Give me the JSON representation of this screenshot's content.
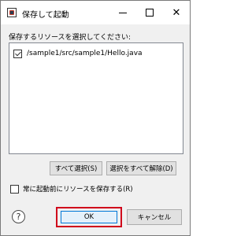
{
  "window": {
    "title": "保存して起動",
    "app_icon": "eclipse-app-icon",
    "controls": {
      "minimize": "minimize-icon",
      "maximize": "maximize-icon",
      "close": "close-icon",
      "close_glyph": "✕"
    }
  },
  "prompt": "保存するリソースを選択してください:",
  "resources": [
    {
      "label": "/sample1/src/sample1/Hello.java",
      "checked": true
    }
  ],
  "buttons": {
    "select_all": "すべて選択(S)",
    "deselect_all": "選択をすべて解除(D)",
    "ok": "OK",
    "cancel": "キャンセル"
  },
  "save_before_launch": {
    "label": "常に起動前にリソースを保存する(R)",
    "checked": false
  },
  "help": {
    "glyph": "?",
    "icon": "help-icon"
  },
  "colors": {
    "highlight": "#d0021b",
    "default_button_border": "#0078d7"
  }
}
